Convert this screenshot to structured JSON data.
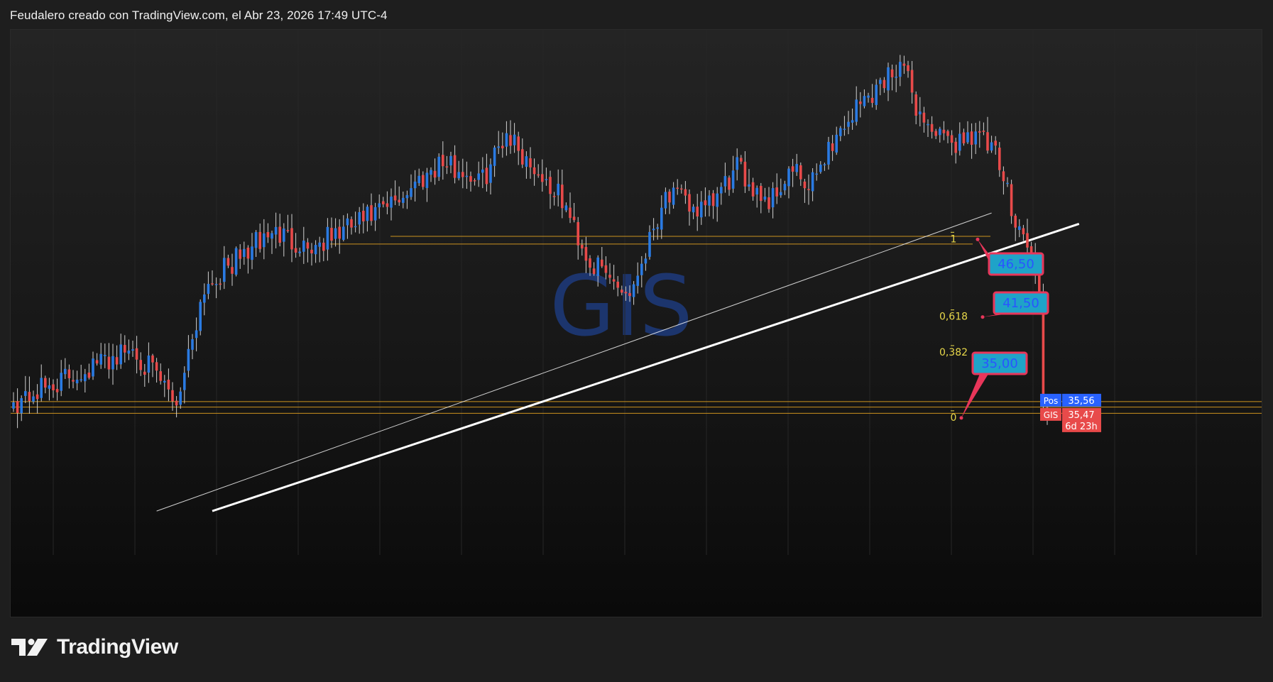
{
  "header": {
    "title": "Feudalero creado con TradingView.com, el Abr 23, 2026 17:49 UTC-4"
  },
  "footer": {
    "brand": "TradingView"
  },
  "chart_data": {
    "type": "candlestick",
    "symbol_watermark": "GIS",
    "y_range": [
      28,
      60
    ],
    "colors": {
      "up": "#2a7ae2",
      "down": "#e84a4a",
      "wick": "#d0d0d0",
      "level": "#e0a020",
      "fib_label": "#e8d84a",
      "trendline": "#ffffff",
      "callout_fill": "#1fa3c8",
      "callout_border": "#e8365a",
      "callout_text": "#2a55ff",
      "watermark": "#1e3f8a",
      "pos_badge": "#2962ff",
      "price_badge": "#e84a4a"
    },
    "anchors": [
      [
        0,
        36.0
      ],
      [
        30,
        39.5
      ],
      [
        41,
        36.0
      ],
      [
        48,
        43.5
      ],
      [
        65,
        47.0
      ],
      [
        75,
        46.0
      ],
      [
        94,
        48.5
      ],
      [
        107,
        51.5
      ],
      [
        118,
        50.3
      ],
      [
        124,
        53.5
      ],
      [
        128,
        52.0
      ],
      [
        138,
        49.0
      ],
      [
        145,
        45.0
      ],
      [
        155,
        43.0
      ],
      [
        164,
        49.5
      ],
      [
        174,
        48.2
      ],
      [
        182,
        51.0
      ],
      [
        190,
        49.0
      ],
      [
        196,
        51.0
      ],
      [
        200,
        49.5
      ],
      [
        204,
        52.0
      ],
      [
        212,
        55.0
      ],
      [
        218,
        56.5
      ],
      [
        223,
        58.0
      ],
      [
        228,
        54.5
      ],
      [
        235,
        52.5
      ],
      [
        242,
        53.5
      ],
      [
        247,
        51.8
      ],
      [
        252,
        48.0
      ],
      [
        256,
        45.5
      ],
      [
        258,
        42.5
      ],
      [
        259,
        35.8
      ],
      [
        260,
        35.47
      ]
    ],
    "last_price": "35,47",
    "position_price": "35,56",
    "countdown": "6d 23h",
    "badges": {
      "pos_label": "Pos",
      "symbol_label": "GIS"
    },
    "horizontal_levels": [
      46.7,
      46.2,
      36.05,
      35.7,
      35.3
    ],
    "fib_levels": [
      {
        "label": "1",
        "value": 46.5
      },
      {
        "label": "0,618",
        "value": 41.5
      },
      {
        "label": "0,382",
        "value": 39.2
      },
      {
        "label": "0",
        "value": 35.0
      }
    ],
    "callouts": [
      {
        "text": "46,50",
        "value": 46.5
      },
      {
        "text": "41,50",
        "value": 41.5
      },
      {
        "text": "35,00",
        "value": 35.0
      }
    ],
    "trendlines": [
      {
        "from": [
          36,
          29.0
        ],
        "to": [
          246,
          48.2
        ],
        "style": "thin"
      },
      {
        "from": [
          50,
          29.0
        ],
        "to": [
          268,
          47.5
        ],
        "style": "thick"
      }
    ]
  }
}
